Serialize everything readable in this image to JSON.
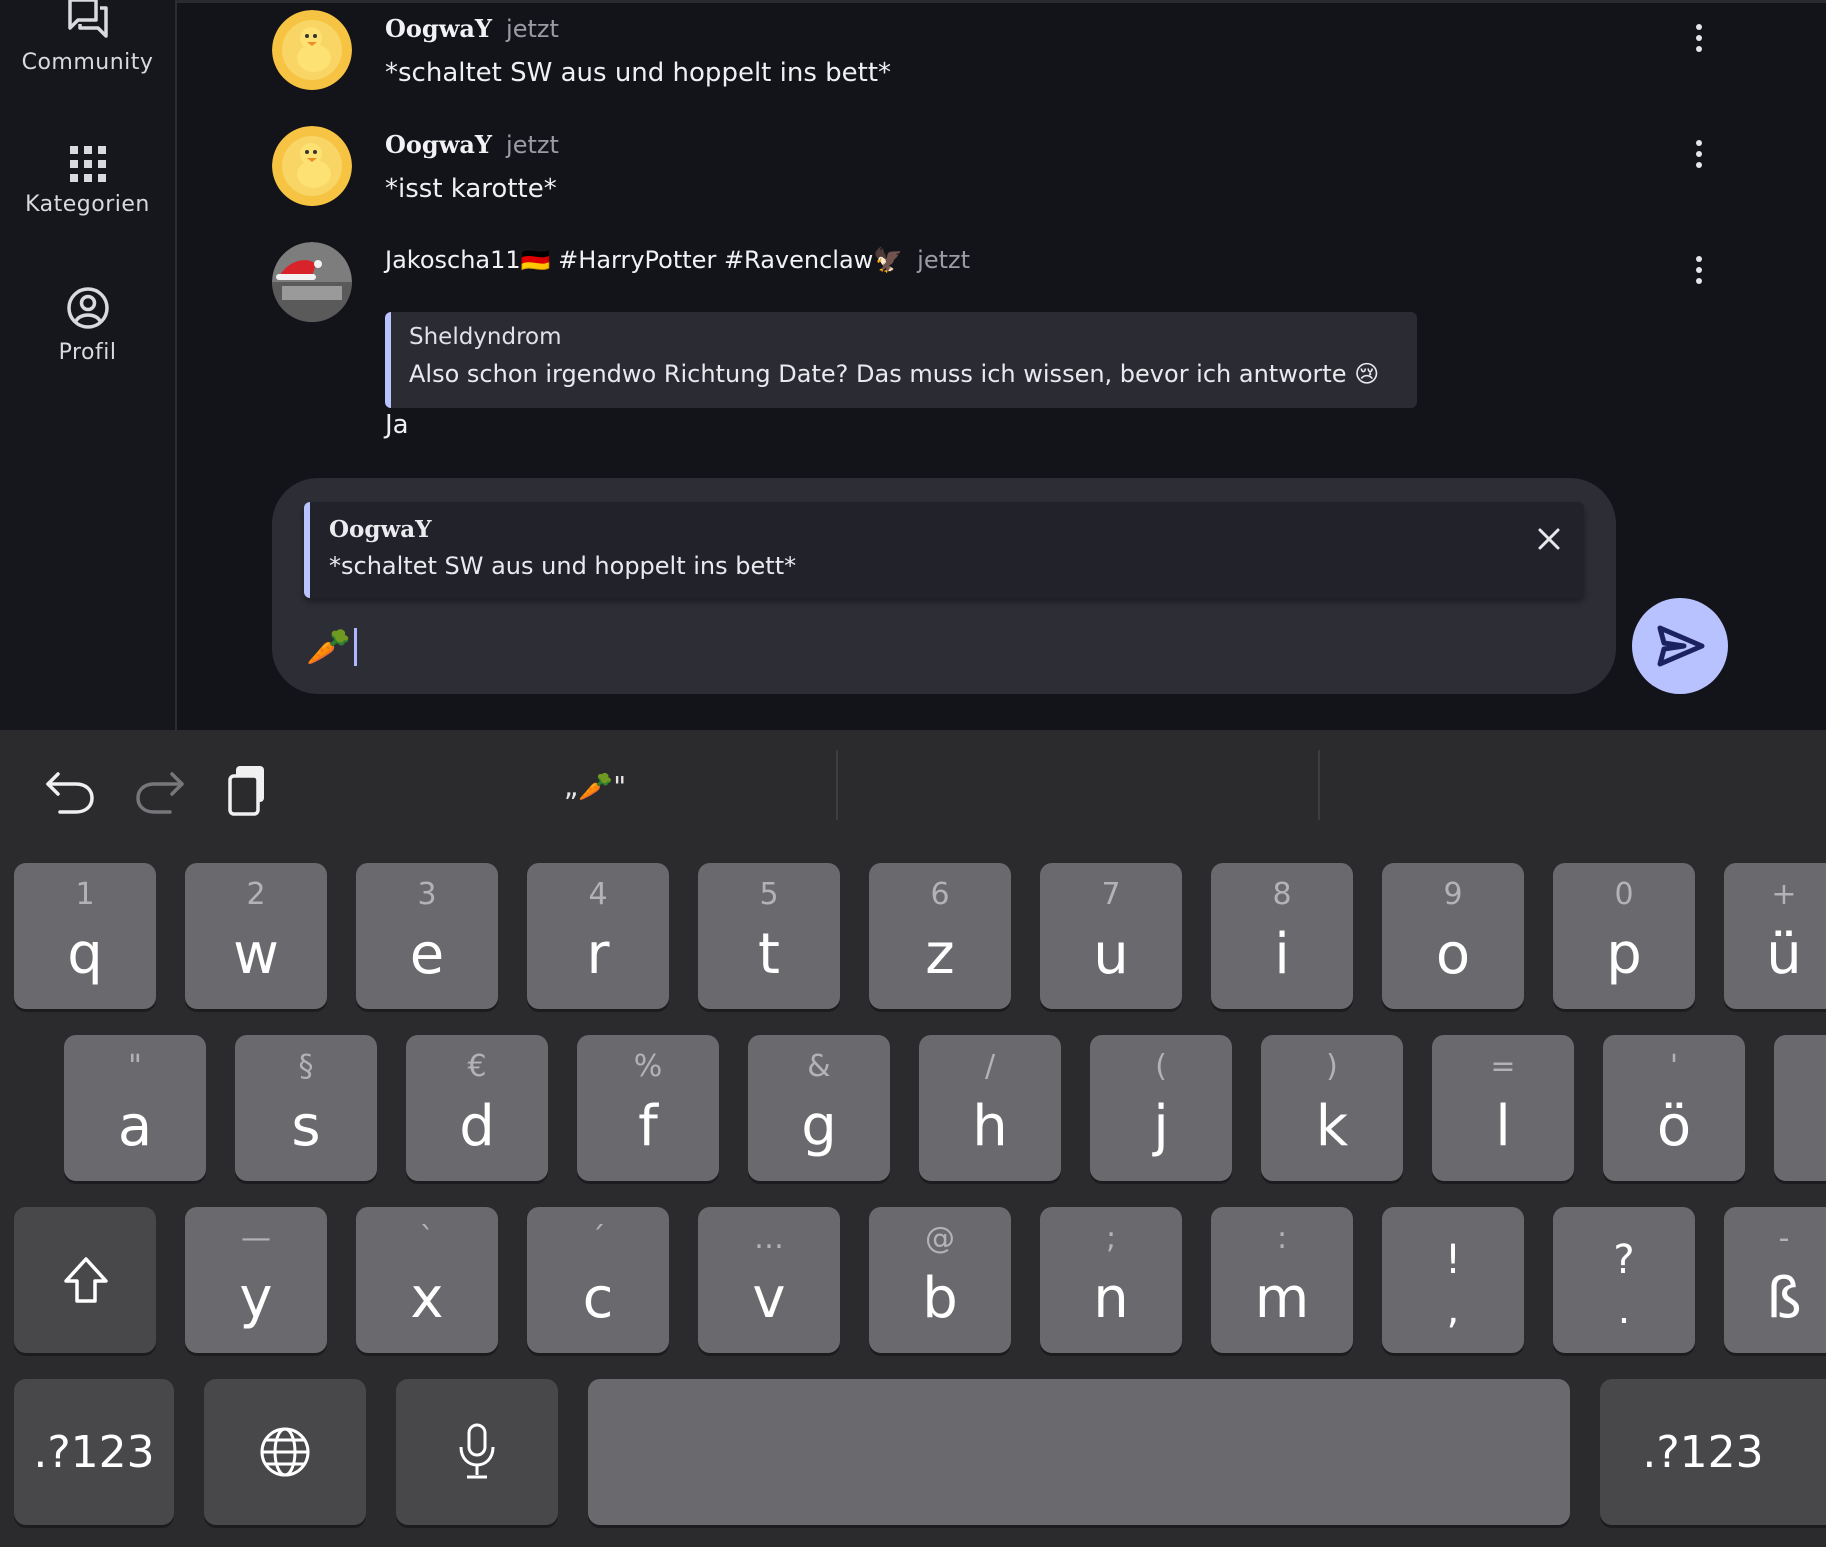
{
  "sidebar": {
    "items": [
      {
        "label": "Community",
        "icon": "forum-icon"
      },
      {
        "label": "Kategorien",
        "icon": "grid-icon"
      },
      {
        "label": "Profil",
        "icon": "account-circle-icon"
      }
    ]
  },
  "messages": [
    {
      "user": "OogwaY",
      "time": "jetzt",
      "text": "*schaltet SW aus und hoppelt ins bett*",
      "avatar": "duck-avatar"
    },
    {
      "user": "OogwaY",
      "time": "jetzt",
      "text": "*isst karotte*",
      "avatar": "duck-avatar"
    },
    {
      "user": "Jakoscha11🇩🇪 #HarryPotter #Ravenclaw🦅",
      "time": "jetzt",
      "avatar": "santa-hat-avatar",
      "quote": {
        "user": "Sheldyndrom",
        "text": "Also schon irgendwo Richtung Date? Das muss ich wissen, bevor ich antworte 😢"
      },
      "text": "Ja"
    }
  ],
  "composer": {
    "reply_to": {
      "user": "OogwaY",
      "text": "*schaltet SW aus und hoppelt ins bett*"
    },
    "input_value": "🥕"
  },
  "keyboard": {
    "suggestion": "„🥕\"",
    "rows": [
      [
        {
          "alt": "1",
          "main": "q"
        },
        {
          "alt": "2",
          "main": "w"
        },
        {
          "alt": "3",
          "main": "e"
        },
        {
          "alt": "4",
          "main": "r"
        },
        {
          "alt": "5",
          "main": "t"
        },
        {
          "alt": "6",
          "main": "z"
        },
        {
          "alt": "7",
          "main": "u"
        },
        {
          "alt": "8",
          "main": "i"
        },
        {
          "alt": "9",
          "main": "o"
        },
        {
          "alt": "0",
          "main": "p"
        },
        {
          "alt": "+",
          "main": "ü"
        }
      ],
      [
        {
          "alt": "\"",
          "main": "a"
        },
        {
          "alt": "§",
          "main": "s"
        },
        {
          "alt": "€",
          "main": "d"
        },
        {
          "alt": "%",
          "main": "f"
        },
        {
          "alt": "&",
          "main": "g"
        },
        {
          "alt": "/",
          "main": "h"
        },
        {
          "alt": "(",
          "main": "j"
        },
        {
          "alt": ")",
          "main": "k"
        },
        {
          "alt": "=",
          "main": "l"
        },
        {
          "alt": "'",
          "main": "ö"
        }
      ],
      [
        {
          "alt": "—",
          "main": "y"
        },
        {
          "alt": "`",
          "main": "x"
        },
        {
          "alt": "´",
          "main": "c"
        },
        {
          "alt": "…",
          "main": "v"
        },
        {
          "alt": "@",
          "main": "b"
        },
        {
          "alt": ";",
          "main": "n"
        },
        {
          "alt": ":",
          "main": "m"
        }
      ],
      [
        {
          "top": "!",
          "bot": ","
        },
        {
          "top": "?",
          "bot": "."
        },
        {
          "alt": "-",
          "main": "ß"
        }
      ]
    ],
    "num_key": ".?123"
  }
}
